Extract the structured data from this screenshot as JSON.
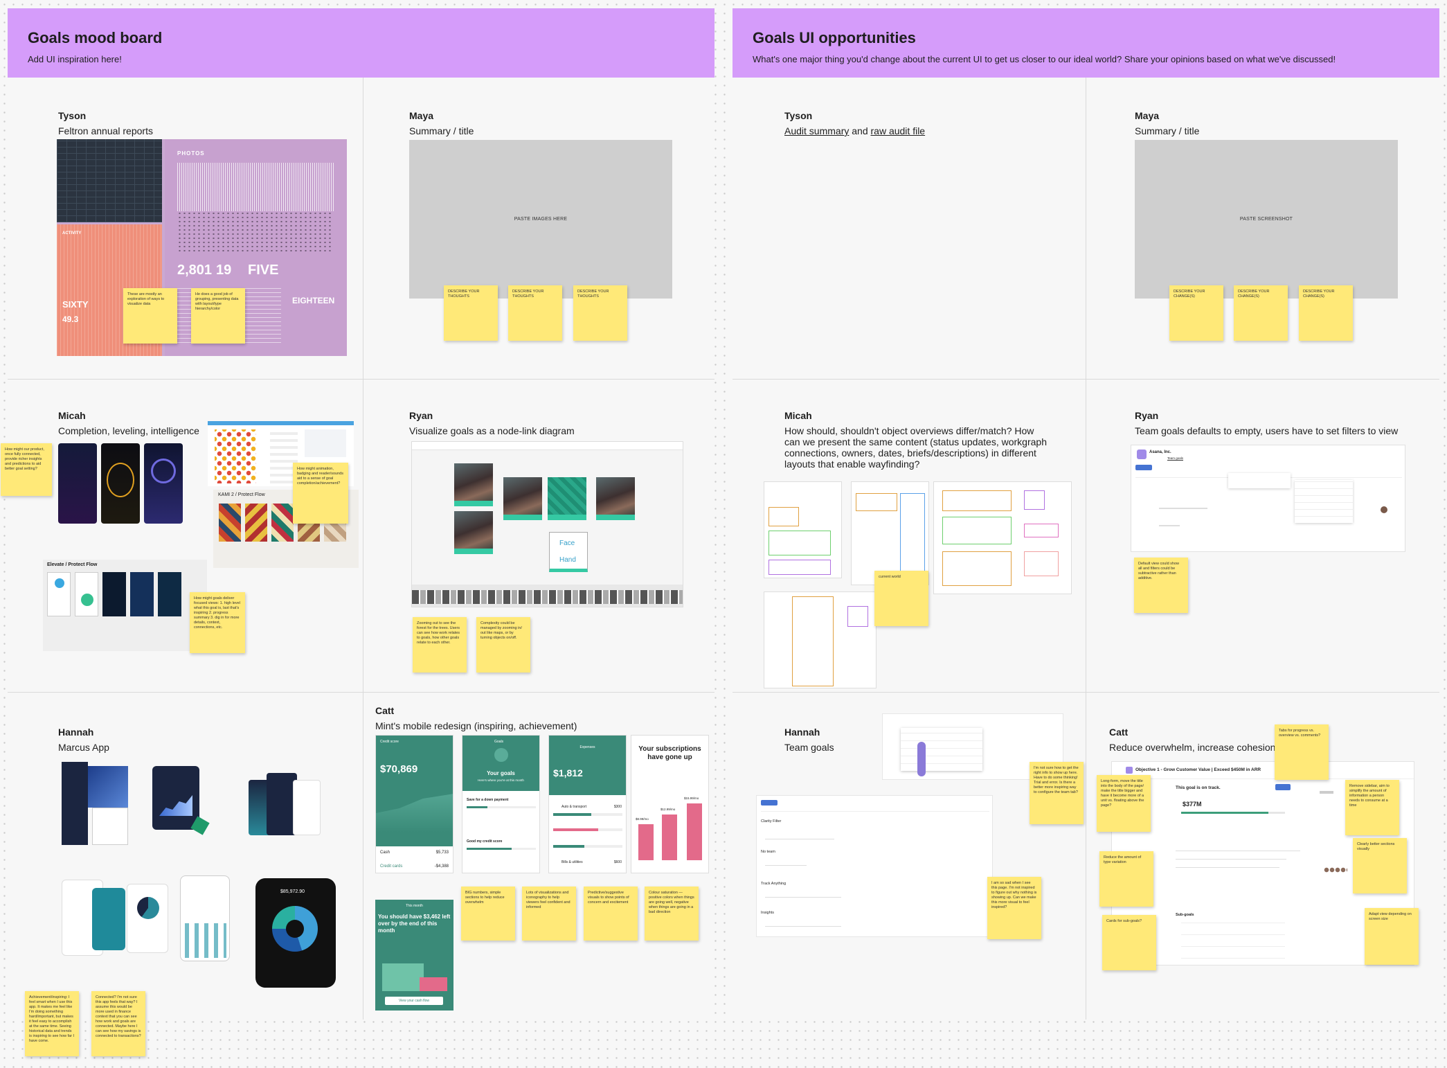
{
  "left_board": {
    "title": "Goals mood board",
    "subtitle": "Add UI inspiration here!",
    "cells": {
      "tyson": {
        "author": "Tyson",
        "topic": "Feltron annual reports",
        "stickies": [
          "These are mostly an exploration of ways to visualize data",
          "He does a good job of grouping, presenting data with layout/type hierarchy/color"
        ],
        "feltron_text": {
          "photos": "PHOTOS",
          "activity": "ACTIVITY",
          "n1": "2,801",
          "n2": "19",
          "n3": "FIVE",
          "n4": "SIXTY",
          "n5": "49.3",
          "n6": "EIGHTEEN"
        }
      },
      "maya": {
        "author": "Maya",
        "topic": "Summary / title",
        "paste": "PASTE IMAGES HERE",
        "stickies": [
          "DESCRIBE YOUR THOUGHTS",
          "DESCRIBE YOUR THOUGHTS",
          "DESCRIBE YOUR THOUGHTS"
        ]
      },
      "micah": {
        "author": "Micah",
        "topic": "Completion, leveling, intelligence",
        "kami_title": "KAMI 2 / Protect Flow",
        "elevate_title": "Elevate / Protect Flow",
        "stickies": [
          "How might our product, once fully connected, provide richer insights and predictions to aid better goal setting?",
          "How might animation, badging and reader/sounds aid to a sense of goal completion/achievement?",
          "How might goals deliver focused views: 1. high level what this goal is, last that's inspiring 2. progress summary 3. dig in for more details, context, connections, etc."
        ]
      },
      "ryan": {
        "author": "Ryan",
        "topic": "Visualize goals as a node-link diagram",
        "node_labels": {
          "face": "Face",
          "hand": "Hand"
        },
        "stickies": [
          "Zooming out to see the forest for the trees. Users can see how work relates to goals, how other goals relate to each other.",
          "Complexity could be managed by zooming in/ out like maps, or by turning objects on/off."
        ]
      },
      "hannah": {
        "author": "Hannah",
        "topic": "Marcus App",
        "amount": "$85,972.90",
        "stickies": [
          "Achievement/inspiring: I feel smart when I use this app. It makes me feel like I'm doing something hard/important, but makes it feel easy to accomplish at the same time. Seeing historical data and trends is inspiring to see how far I have come.",
          "Connected? I'm not sure this app feels that way? I assume this would be more used in finance context that you can see how work and goals are connected. Maybe here I can see how my savings is connected to transactions?"
        ]
      },
      "catt": {
        "author": "Catt",
        "topic": "Mint's mobile redesign (inspiring, achievement)",
        "screens": {
          "s1": {
            "label": "Credit score",
            "value": "$70,869",
            "row1": "Cash",
            "row1v": "$5,733",
            "row2": "Credit cards",
            "row2v": "-$4,388"
          },
          "s2": {
            "label": "Goals",
            "title": "Your goals",
            "sub": "Here's where you're at this month",
            "g1": "Save for a down payment",
            "g2": "Good my credit score"
          },
          "s3": {
            "label": "Expenses",
            "value": "$1,812",
            "r1": "Auto & transport",
            "r1v": "$300",
            "r2": "Bills & utilities",
            "r2v": "$600"
          },
          "s4": {
            "title": "Your subscriptions have gone up",
            "b1": "$8.99/mo",
            "b2": "$12.99/mo",
            "b3": "$15.99/mo"
          },
          "s5": {
            "label": "This month",
            "title": "You should have $3,462 left over by the end of this month",
            "btn": "View your cash flow"
          }
        },
        "stickies": [
          "BIG numbers, simple sections to help reduce overwhelm",
          "Lots of visualizations and iconography to help viewers feel confident and informed",
          "Predictive/suggestive visuals to show points of concern and excitement",
          "Colour saturation — positive colors when things are going well, negative when things are going in a bad direction"
        ]
      }
    }
  },
  "right_board": {
    "title": "Goals UI opportunities",
    "subtitle": "What's one major thing you'd change about the current UI to get us closer to our ideal world? Share your opinions based on what we've discussed!",
    "cells": {
      "tyson": {
        "author": "Tyson",
        "link1": "Audit summary",
        "connector": " and ",
        "link2": "raw audit file"
      },
      "maya": {
        "author": "Maya",
        "topic": "Summary / title",
        "paste": "PASTE SCREENSHOT",
        "stickies": [
          "DESCRIBE YOUR CHANGE(S)",
          "DESCRIBE YOUR CHANGE(S)",
          "DESCRIBE YOUR CHANGE(S)"
        ]
      },
      "micah": {
        "author": "Micah",
        "topic": "How should, shouldn't object overviews differ/match? How can we present the same content (status updates, workgraph connections, owners, dates, briefs/descriptions) in different layouts that enable wayfinding?",
        "stickies": [
          "current world"
        ]
      },
      "ryan": {
        "author": "Ryan",
        "topic": "Team goals defaults to empty, users have to set filters to view",
        "app_name": "Asana, Inc.",
        "tab": "Team goals",
        "stickies": [
          "Default view could show all and filters could be subtractive rather than additive."
        ]
      },
      "hannah": {
        "author": "Hannah",
        "topic": "Team goals",
        "rows": [
          "Clarity Filter",
          "No team",
          "Track Anything",
          "Insights"
        ],
        "stickies": [
          "I'm not sure how to get the right info to show up here. Have to do some thinking! Trial and error. Is there a better more inspiring way to configure the team tab?",
          "I am so sad when I see this page. I'm not inspired to figure out why nothing is showing up. Can we make this more visual to feel inspired?"
        ]
      },
      "catt": {
        "author": "Catt",
        "topic": "Reduce overwhelm, increase cohesion",
        "goal_title": "Objective 1 - Grow Customer Value | Exceed $450M in ARR",
        "status": "This goal is on track.",
        "amount": "$377M",
        "subgoals_label": "Sub-goals",
        "stickies": [
          "Tabs for progress vs. overview vs. comments?",
          "Long-form, move the title into the body of the page/ make the title bigger and have it become more of a unit vs. floating above the page?",
          "Reduce the amount of type variation",
          "Cards for sub-goals?",
          "Remove sidebar, aim to simplify the amount of information a person needs to consume at a time",
          "Clearly better sections visually",
          "Adapt view depending on screen size"
        ]
      }
    }
  },
  "colors": {
    "header": "#d59cfa",
    "sticky": "#ffe978",
    "mint_teal": "#3a8a78",
    "placeholder": "#cfcfcf"
  }
}
